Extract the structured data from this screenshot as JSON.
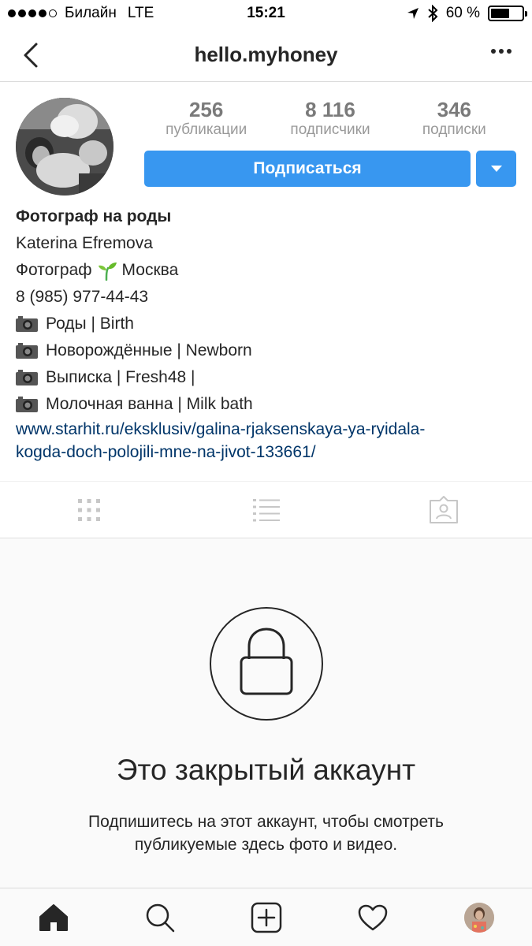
{
  "status_bar": {
    "carrier": "Билайн",
    "network": "LTE",
    "time": "15:21",
    "battery": "60 %",
    "battery_level": 0.6
  },
  "navbar": {
    "title": "hello.myhoney"
  },
  "profile": {
    "stats": [
      {
        "value": "256",
        "label": "публикации"
      },
      {
        "value": "8 116",
        "label": "подписчики"
      },
      {
        "value": "346",
        "label": "подписки"
      }
    ],
    "follow_label": "Подписаться"
  },
  "bio": {
    "name": "Фотограф на роды",
    "full_name": "Katerina Efremova",
    "line1_pre": "Фотограф",
    "line1_post": "Москва",
    "phone": "8 (985) 977-44-43",
    "items": [
      "Роды | Birth",
      "Новорождённые | Newborn",
      "Выписка | Fresh48 |",
      "Молочная ванна | Milk bath"
    ],
    "link_line1": "www.starhit.ru/eksklusiv/galina-rjaksenskaya-ya-ryidala-",
    "link_line2": "kogda-doch-polojili-mne-na-jivot-133661/"
  },
  "private": {
    "title": "Это закрытый аккаунт",
    "subtitle_line1": "Подпишитесь на этот аккаунт, чтобы смотреть",
    "subtitle_line2": "публикуемые здесь фото и видео."
  },
  "colors": {
    "accent": "#3897f0",
    "link": "#003569",
    "text": "#262626"
  }
}
